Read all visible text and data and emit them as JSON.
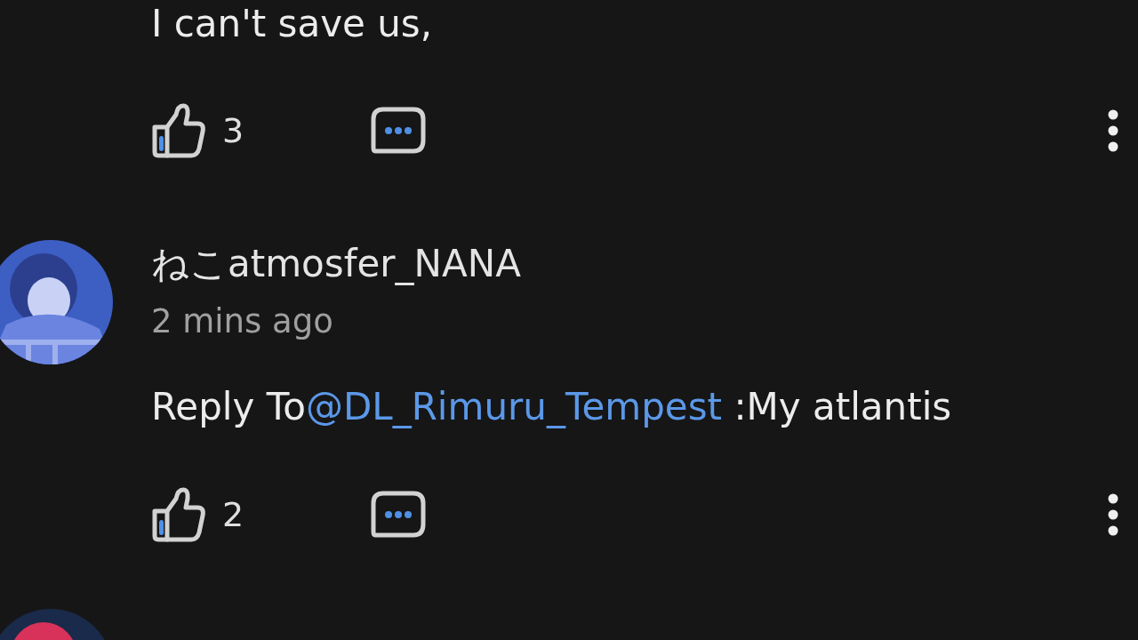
{
  "comments": [
    {
      "body": "I can't save us,",
      "likes": "3"
    },
    {
      "avatar": {
        "kind": "picture"
      },
      "author": "ねこatmosfer_NANA",
      "time": "2 mins ago",
      "reply_prefix": "Reply To",
      "mention": "@DL_Rimuru_Tempest",
      "body": " :My atlantis",
      "likes": "2"
    },
    {
      "avatar": {
        "kind": "picture"
      }
    }
  ]
}
